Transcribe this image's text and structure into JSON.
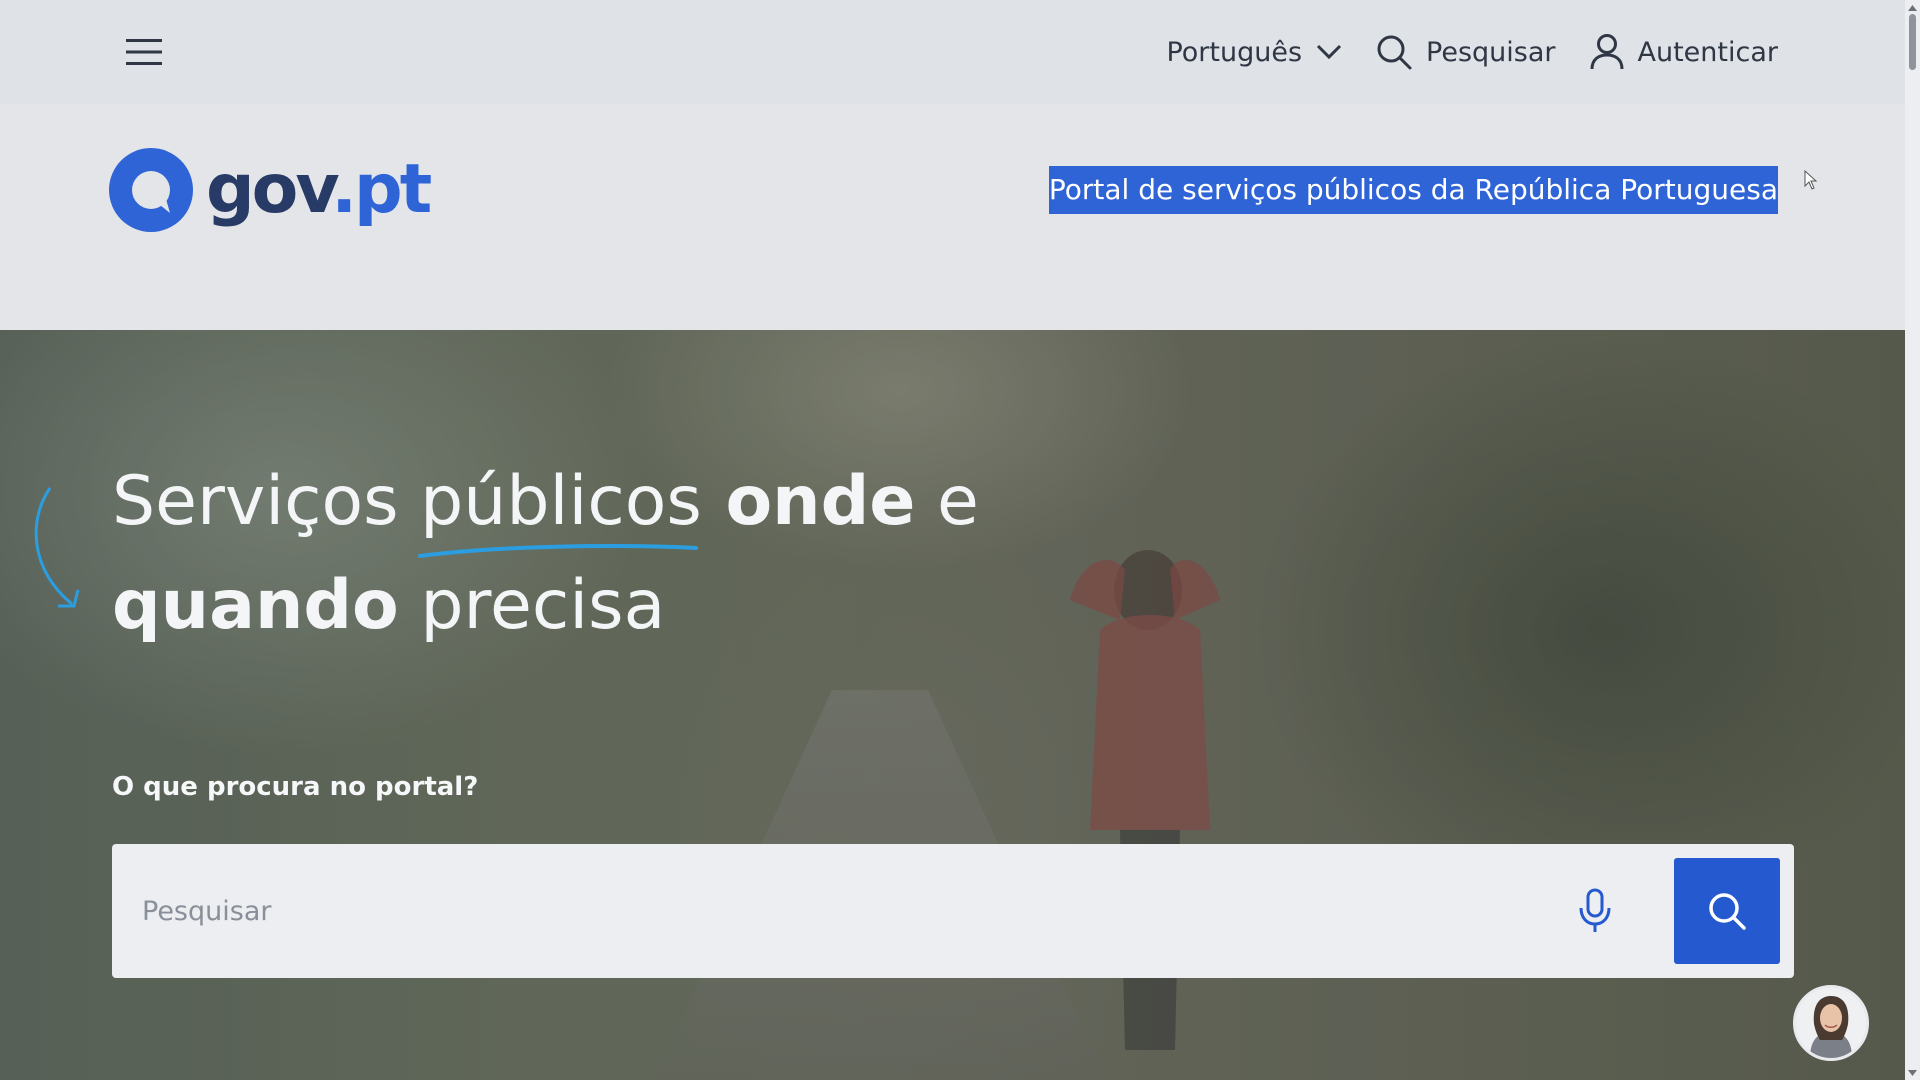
{
  "topbar": {
    "menu_icon": "hamburger-menu-icon",
    "language": {
      "label": "Português",
      "icon": "chevron-down-icon"
    },
    "search": {
      "label": "Pesquisar",
      "icon": "search-icon"
    },
    "login": {
      "label": "Autenticar",
      "icon": "user-icon"
    }
  },
  "brand": {
    "logo_text_main": "gov",
    "logo_text_dot": ".",
    "logo_text_pt": "pt",
    "tagline": "Portal de serviços públicos da República Portuguesa"
  },
  "hero": {
    "title_part1": "Serviços ",
    "title_word_underlined": "públicos",
    "title_part2_bold": " onde",
    "title_part3": " e",
    "title_line2_bold": "quando",
    "title_line2_rest": " precisa",
    "search_label": "O que procura no portal?",
    "search_placeholder": "Pesquisar",
    "mic_icon": "microphone-icon",
    "search_button_icon": "search-icon"
  },
  "assistant": {
    "icon": "assistant-avatar"
  },
  "colors": {
    "brand_blue": "#2f64d6",
    "logo_dark": "#283a66",
    "search_button": "#2459d0",
    "underline_accent": "#2a9ee0"
  }
}
